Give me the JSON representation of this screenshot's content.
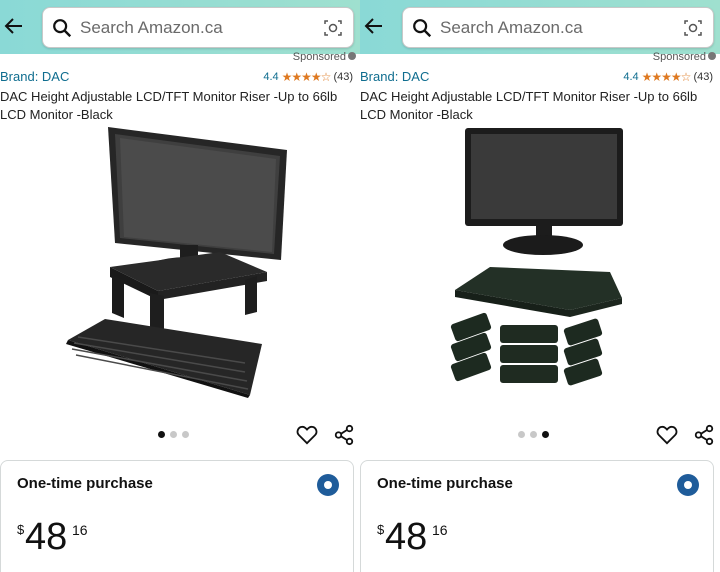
{
  "panels": [
    {
      "search": {
        "placeholder": "Search Amazon.ca"
      },
      "sponsored": "Sponsored",
      "brand": "Brand: DAC",
      "rating": {
        "value": "4.4",
        "stars": "★★★★☆",
        "count": "(43)"
      },
      "title": "DAC Height Adjustable LCD/TFT Monitor Riser -Up to 66lb LCD Monitor -Black",
      "carousel": {
        "total": 3,
        "active": 1
      },
      "purchase": {
        "label": "One-time purchase",
        "currency": "$",
        "whole": "48",
        "fraction": "16"
      }
    },
    {
      "search": {
        "placeholder": "Search Amazon.ca"
      },
      "sponsored": "Sponsored",
      "brand": "Brand: DAC",
      "rating": {
        "value": "4.4",
        "stars": "★★★★☆",
        "count": "(43)"
      },
      "title": "DAC Height Adjustable LCD/TFT Monitor Riser -Up to 66lb LCD Monitor -Black",
      "carousel": {
        "total": 3,
        "active": 3
      },
      "purchase": {
        "label": "One-time purchase",
        "currency": "$",
        "whole": "48",
        "fraction": "16"
      }
    }
  ],
  "colors": {
    "header_gradient_start": "#8ad9d6",
    "header_gradient_end": "#9fe0cf",
    "link": "#0f6d8f",
    "star": "#de7921",
    "radio": "#1f5c9a"
  }
}
